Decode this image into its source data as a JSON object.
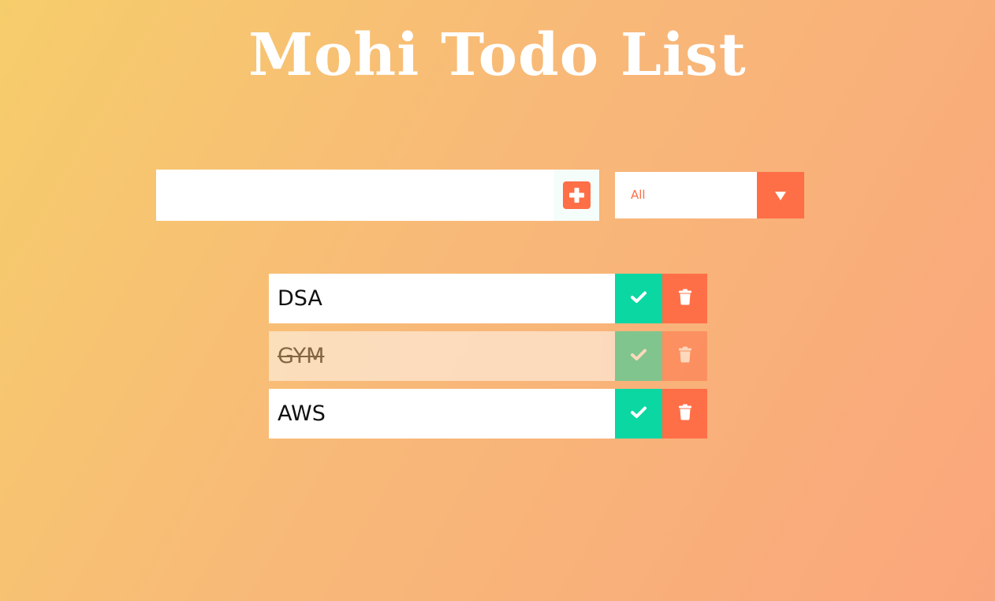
{
  "header": {
    "title": "Mohi Todo List"
  },
  "form": {
    "input_value": "",
    "add_icon": "plus-square-icon",
    "filter_selected": "All",
    "filter_icon": "triangle-down-icon"
  },
  "todos": [
    {
      "text": "DSA",
      "completed": false,
      "check_icon": "check-icon",
      "delete_icon": "trash-icon"
    },
    {
      "text": "GYM",
      "completed": true,
      "check_icon": "check-icon",
      "delete_icon": "trash-icon"
    },
    {
      "text": "AWS",
      "completed": false,
      "check_icon": "check-icon",
      "delete_icon": "trash-icon"
    }
  ],
  "colors": {
    "accent": "#ff6f47",
    "complete": "#0bd7a3",
    "text": "#111111",
    "white": "#ffffff"
  }
}
